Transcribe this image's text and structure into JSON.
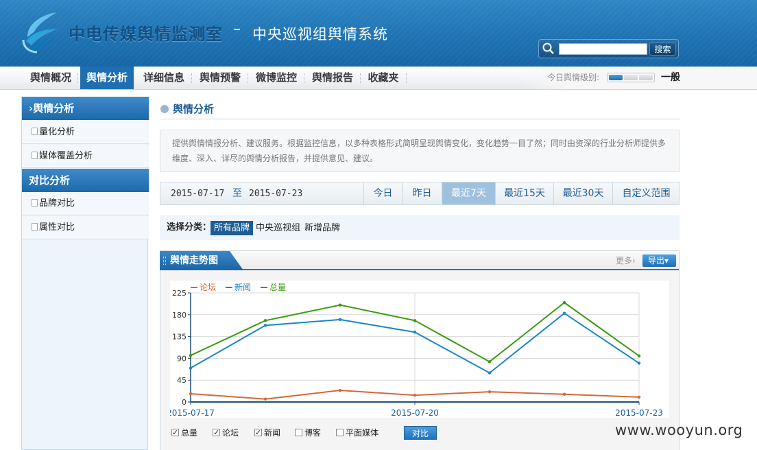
{
  "header": {
    "title_main": "中电传媒舆情监测室",
    "title_dash": "–",
    "title_sub": "中央巡视组舆情系统",
    "search": {
      "placeholder": "",
      "button_label": "搜索"
    }
  },
  "nav": {
    "items": [
      {
        "label": "舆情概况"
      },
      {
        "label": "舆情分析",
        "active": true
      },
      {
        "label": "详细信息"
      },
      {
        "label": "舆情预警"
      },
      {
        "label": "微博监控"
      },
      {
        "label": "舆情报告"
      },
      {
        "label": "收藏夹"
      }
    ],
    "level_label": "今日舆情级别:",
    "level_value": "一般",
    "level_fraction": 0.33
  },
  "sidebar": {
    "sections": [
      {
        "title": "舆情分析",
        "items": [
          "量化分析",
          "媒体覆盖分析"
        ]
      },
      {
        "title": "对比分析",
        "items": [
          "品牌对比",
          "属性对比"
        ]
      }
    ]
  },
  "main": {
    "title": "舆情分析",
    "description": "提供舆情情报分析、建议服务。根据监控信息，以多种表格形式简明呈现舆情变化，变化趋势一目了然；同时由资深的行业分析师提供多维度、深入、详尽的舆情分析报告，并提供意见、建议。",
    "date_from": "2015-07-17",
    "date_sep": "至",
    "date_to": "2015-07-23",
    "ranges": [
      "今日",
      "昨日",
      "最近7天",
      "最近15天",
      "最近30天",
      "自定义范围"
    ],
    "active_range": "最近7天",
    "filter_label": "选择分类：",
    "filter_options": [
      "所有品牌",
      "中央巡视组",
      "新增品牌"
    ],
    "active_filter": "所有品牌",
    "panel_title": "舆情走势图",
    "more_label": "更多›",
    "export_label": "导出▾",
    "checks": [
      {
        "label": "总量",
        "checked": true
      },
      {
        "label": "论坛",
        "checked": true
      },
      {
        "label": "新闻",
        "checked": true
      },
      {
        "label": "博客",
        "checked": false
      },
      {
        "label": "平面媒体",
        "checked": false
      }
    ],
    "compare_label": "对比"
  },
  "colors": {
    "brand": "#1e6fb2",
    "forum": "#d2693a",
    "news": "#1a86c6",
    "total": "#3a9a0f"
  },
  "chart_data": {
    "type": "line",
    "x": [
      "2015-07-17",
      "2015-07-18",
      "2015-07-19",
      "2015-07-20",
      "2015-07-21",
      "2015-07-22",
      "2015-07-23"
    ],
    "x_tick_labels": [
      "2015-07-17",
      "2015-07-20",
      "2015-07-23"
    ],
    "series": [
      {
        "name": "论坛",
        "values": [
          17,
          6,
          24,
          14,
          21,
          16,
          10
        ]
      },
      {
        "name": "新闻",
        "values": [
          70,
          158,
          170,
          144,
          60,
          183,
          80
        ]
      },
      {
        "name": "总量",
        "values": [
          96,
          168,
          200,
          168,
          83,
          205,
          95
        ]
      }
    ],
    "ylim": [
      0,
      225
    ],
    "y_ticks": [
      0,
      45,
      90,
      135,
      180,
      225
    ],
    "grid": true,
    "legend_position": "top-left"
  },
  "watermark": "www.wooyun.org"
}
